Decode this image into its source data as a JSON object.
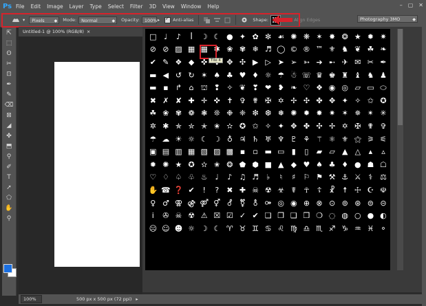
{
  "app": {
    "logo": "Ps"
  },
  "menu": [
    "File",
    "Edit",
    "Image",
    "Layer",
    "Type",
    "Select",
    "Filter",
    "3D",
    "View",
    "Window",
    "Help"
  ],
  "window_controls": [
    "–",
    "▢",
    "✕"
  ],
  "options": {
    "tool_icon": "custom-shape-tool-icon",
    "pick_mode": "Pixels",
    "mode_label": "Mode:",
    "mode_value": "Normal",
    "opacity_label": "Opacity:",
    "opacity_value": "100%",
    "antialias_label": "Anti-alias",
    "shape_label": "Shape:",
    "align_edges_label": "Align Edges",
    "workspace": "Photography 3MO"
  },
  "document": {
    "tab_title": "Untitled-1 @ 100% (RGB/8)",
    "zoom": "100%",
    "info": "500 px x 500 px (72 ppi)"
  },
  "picker": {
    "tooltip": "Tile 4",
    "shapes": [
      "□",
      "♩",
      "♪",
      "ꟾ",
      "☽",
      "☾",
      "●",
      "✦",
      "✿",
      "✼",
      "☙",
      "✺",
      "❋",
      "✶",
      "✸",
      "❂",
      "★",
      "✹",
      "✷",
      "⊘",
      "⊘",
      "▨",
      "▦",
      "▦",
      "✱",
      "❀",
      "✾",
      "❄",
      "♬",
      "◯",
      "©",
      "®",
      "™",
      "⚜",
      "♞",
      "❦",
      "☘",
      "❧",
      "✔",
      "✎",
      "❖",
      "◆",
      "✜",
      "✤",
      "✥",
      "✣",
      "▶",
      "▷",
      "➤",
      "➢",
      "➳",
      "➔",
      "➸",
      "✈",
      "✉",
      "✂",
      "✒",
      "▬",
      "◀",
      "↺",
      "↻",
      "✶",
      "♠",
      "♣",
      "♥",
      "♦",
      "☼",
      "☂",
      "☃",
      "☏",
      "♛",
      "♚",
      "♜",
      "♝",
      "♞",
      "♟",
      "▬",
      "▪",
      "↱",
      "⌂",
      "⛫",
      "❢",
      "✧",
      "❦",
      "❣",
      "❤",
      "❥",
      "❧",
      "♡",
      "❖",
      "◉",
      "◎",
      "▱",
      "▭",
      "⬭",
      "✖",
      "✗",
      "✘",
      "✚",
      "✛",
      "✜",
      "✝",
      "✞",
      "✟",
      "✠",
      "✡",
      "✢",
      "✣",
      "✤",
      "✥",
      "✦",
      "✧",
      "✩",
      "✪",
      "☘",
      "❀",
      "✾",
      "❁",
      "❃",
      "❊",
      "❉",
      "❈",
      "❇",
      "❆",
      "❅",
      "✺",
      "✹",
      "✸",
      "✷",
      "✶",
      "✵",
      "✴",
      "✳",
      "✲",
      "✱",
      "✯",
      "✮",
      "✭",
      "✬",
      "✫",
      "✪",
      "✩",
      "✧",
      "✦",
      "✥",
      "✤",
      "✣",
      "✢",
      "✡",
      "✠",
      "✟",
      "✞",
      "☂",
      "☁",
      "☀",
      "☼",
      "☾",
      "☽",
      "♁",
      "♃",
      "♄",
      "♅",
      "♆",
      "♇",
      "⚘",
      "⚚",
      "⚛",
      "⚜",
      "⚝",
      "⚞",
      "⚟",
      "▣",
      "▤",
      "▥",
      "▦",
      "▧",
      "▨",
      "▩",
      "▪",
      "▫",
      "▬",
      "▭",
      "▮",
      "▯",
      "▰",
      "▱",
      "▲",
      "△",
      "▴",
      "▵",
      "✹",
      "✺",
      "★",
      "✪",
      "✫",
      "✬",
      "❂",
      "⬟",
      "⬢",
      "■",
      "▲",
      "◆",
      "♥",
      "♠",
      "♣",
      "♦",
      "●",
      "☗",
      "☖",
      "♡",
      "♢",
      "♤",
      "♧",
      "♨",
      "♩",
      "♪",
      "♫",
      "♬",
      "♭",
      "♮",
      "♯",
      "⚐",
      "⚑",
      "⚒",
      "⚓",
      "⚔",
      "⚕",
      "⚖",
      "✋",
      "☎",
      "❓",
      "✔",
      "!",
      "?",
      "✖",
      "✚",
      "☠",
      "☢",
      "☣",
      "☤",
      "☥",
      "☦",
      "☧",
      "☨",
      "☩",
      "☪",
      "☫",
      "♀",
      "♂",
      "⚢",
      "⚣",
      "⚤",
      "⚥",
      "⚦",
      "⚧",
      "⚨",
      "⚩",
      "◎",
      "◉",
      "⊕",
      "⊗",
      "⊙",
      "⊚",
      "⊛",
      "⊜",
      "⊝",
      "i",
      "✇",
      "☠",
      "☢",
      "⚠",
      "☒",
      "☑",
      "✓",
      "✔",
      "❏",
      "❐",
      "❑",
      "❒",
      "❍",
      "◌",
      "◍",
      "○",
      "●",
      "◐",
      "☹",
      "☺",
      "☻",
      "☼",
      "☽",
      "☾",
      "♈",
      "♉",
      "♊",
      "♋",
      "♌",
      "♍",
      "♎",
      "♏",
      "♐",
      "♑",
      "♒",
      "♓",
      "⚬"
    ]
  },
  "tools": [
    "⇱",
    "⬚",
    "ʘ",
    "✂",
    "⊡",
    "✒",
    "✎",
    "⌫",
    "⊠",
    "◢",
    "✤",
    "⬒",
    "⚲",
    "✐",
    "T",
    "➚",
    "⬠",
    "✋",
    "⚲"
  ]
}
